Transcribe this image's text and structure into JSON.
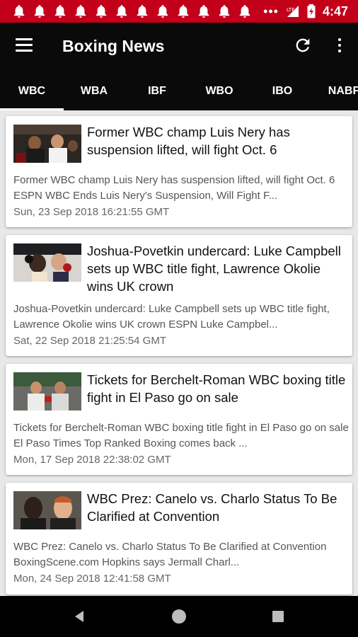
{
  "status_bar": {
    "notification_icons": [
      "bell-icon",
      "bell-icon",
      "bell-icon",
      "bell-icon",
      "bell-icon",
      "bell-icon",
      "bell-icon",
      "bell-icon",
      "bell-icon",
      "bell-icon",
      "bell-icon",
      "bell-icon"
    ],
    "overflow": "•••",
    "network_label": "LTE",
    "time": "4:47",
    "color": "#c2001a"
  },
  "app_bar": {
    "title": "Boxing News",
    "background": "#0a0a0a"
  },
  "tabs": [
    {
      "label": "WBC",
      "active": true
    },
    {
      "label": "WBA",
      "active": false
    },
    {
      "label": "IBF",
      "active": false
    },
    {
      "label": "WBO",
      "active": false
    },
    {
      "label": "IBO",
      "active": false
    },
    {
      "label": "NABF",
      "active": false
    }
  ],
  "articles": [
    {
      "headline": "Former WBC champ Luis Nery has suspension lifted, will fight Oct. 6",
      "summary": "Former WBC champ Luis Nery has suspension lifted, will fight Oct. 6  ESPN  WBC Ends Luis Nery's Suspension, Will Fight F...",
      "date": "Sun, 23 Sep 2018 16:21:55 GMT"
    },
    {
      "headline": "Joshua-Povetkin undercard: Luke Campbell sets up WBC title fight, Lawrence Okolie wins UK crown",
      "summary": "Joshua-Povetkin undercard: Luke Campbell sets up WBC title fight, Lawrence Okolie wins UK crown  ESPN  Luke Campbel...",
      "date": "Sat, 22 Sep 2018 21:25:54 GMT"
    },
    {
      "headline": "Tickets for Berchelt-Roman WBC boxing title fight in El Paso go on sale",
      "summary": "Tickets for Berchelt-Roman WBC boxing title fight in El Paso go on sale  El Paso Times  Top Ranked Boxing comes back ...",
      "date": "Mon, 17 Sep 2018 22:38:02 GMT"
    },
    {
      "headline": "WBC Prez: Canelo vs. Charlo Status To Be Clarified at Convention",
      "summary": "WBC Prez: Canelo vs. Charlo Status To Be Clarified at Convention  BoxingScene.com  Hopkins says Jermall Charl...",
      "date": "Mon, 24 Sep 2018 12:41:58 GMT"
    }
  ]
}
